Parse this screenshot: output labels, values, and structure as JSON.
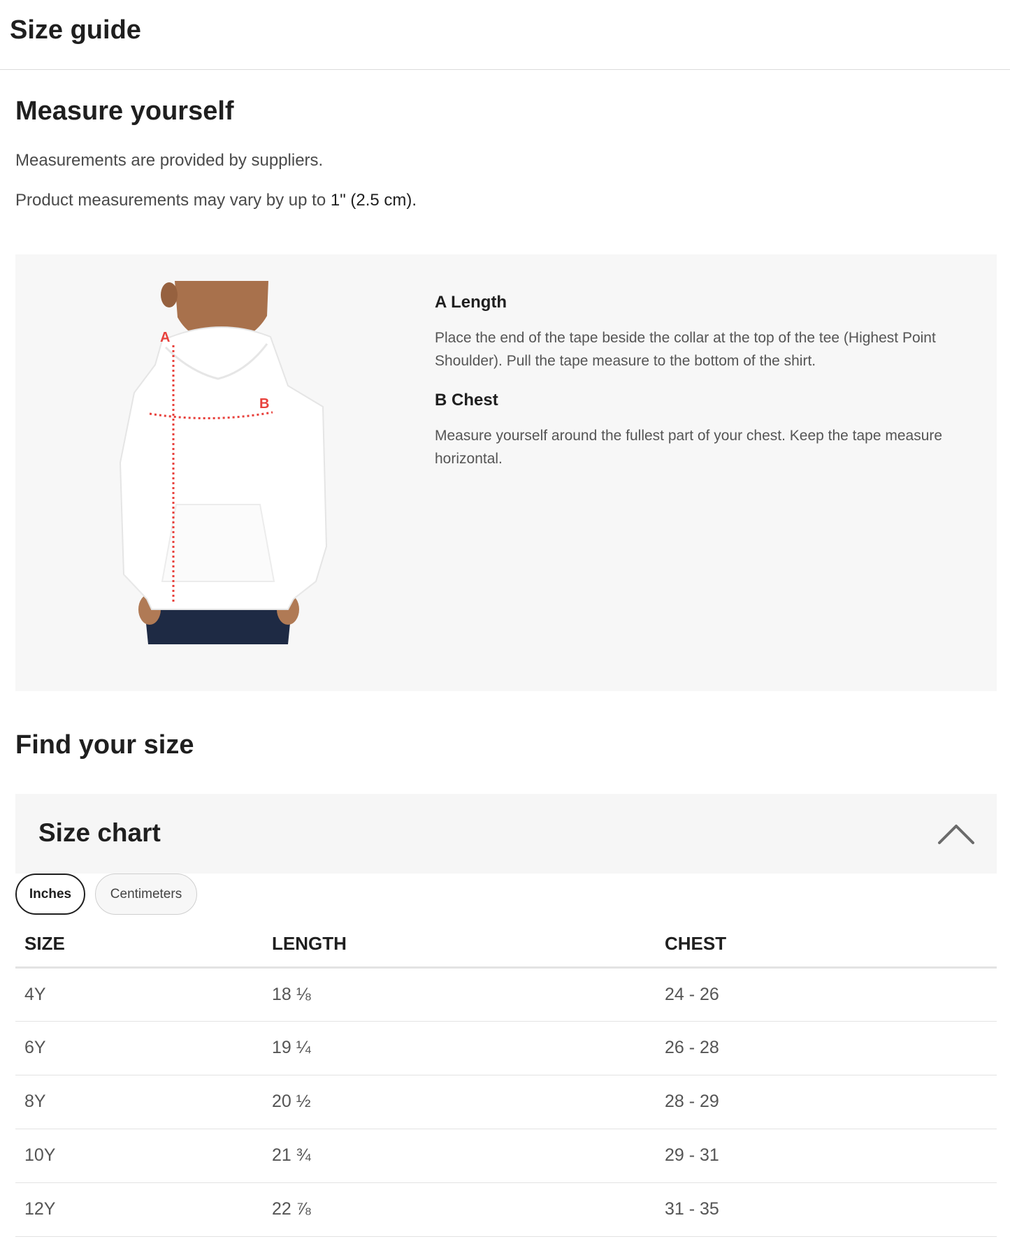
{
  "header": {
    "title": "Size guide"
  },
  "measure": {
    "title": "Measure yourself",
    "note1": "Measurements are provided by suppliers.",
    "note2_prefix": "Product measurements may vary by up to ",
    "note2_value": "1\" (2.5 cm).",
    "image_labels": {
      "a": "A",
      "b": "B"
    },
    "items": [
      {
        "label": "A Length",
        "text": "Place the end of the tape beside the collar at the top of the tee (Highest Point Shoulder). Pull the tape measure to the bottom of the shirt."
      },
      {
        "label": "B Chest",
        "text": "Measure yourself around the fullest part of your chest. Keep the tape measure horizontal."
      }
    ]
  },
  "find": {
    "title": "Find your size"
  },
  "size_chart": {
    "title": "Size chart",
    "units": [
      "Inches",
      "Centimeters"
    ],
    "selected_unit": "Inches",
    "columns": [
      "SIZE",
      "LENGTH",
      "CHEST"
    ],
    "rows": [
      [
        "4Y",
        "18 ⅛",
        "24 - 26"
      ],
      [
        "6Y",
        "19 ¼",
        "26 - 28"
      ],
      [
        "8Y",
        "20 ½",
        "28 - 29"
      ],
      [
        "10Y",
        "21 ¾",
        "29 - 31"
      ],
      [
        "12Y",
        "22 ⅞",
        "31 - 35"
      ]
    ]
  },
  "colors": {
    "accent_measure": "#e8413c",
    "panel_bg": "#f7f7f7"
  }
}
